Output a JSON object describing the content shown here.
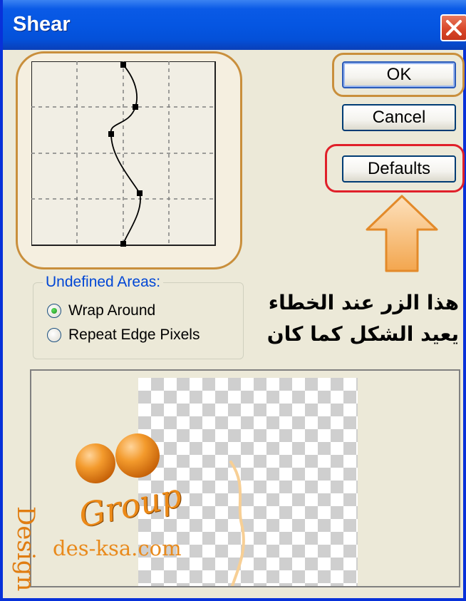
{
  "dialog": {
    "title": "Shear",
    "close_icon": "close-icon"
  },
  "buttons": {
    "ok": "OK",
    "cancel": "Cancel",
    "defaults": "Defaults"
  },
  "undefined_areas": {
    "legend": "Undefined Areas:",
    "options": [
      {
        "label": "Wrap Around",
        "selected": true
      },
      {
        "label": "Repeat Edge Pixels",
        "selected": false
      }
    ]
  },
  "annotation": {
    "line1": "هذا الزر عند الخطاء",
    "line2": "يعيد الشكل كما كان",
    "arrow_icon": "arrow-up-icon"
  },
  "watermark": {
    "word1": "Design",
    "word2": "Group",
    "url": "des-ksa.com"
  },
  "colors": {
    "title_bar": "#0556e2",
    "highlight_ok": "#c98f3c",
    "highlight_defaults": "#e0202a",
    "arrow": "#f5b36a",
    "legend_text": "#0046d5"
  }
}
